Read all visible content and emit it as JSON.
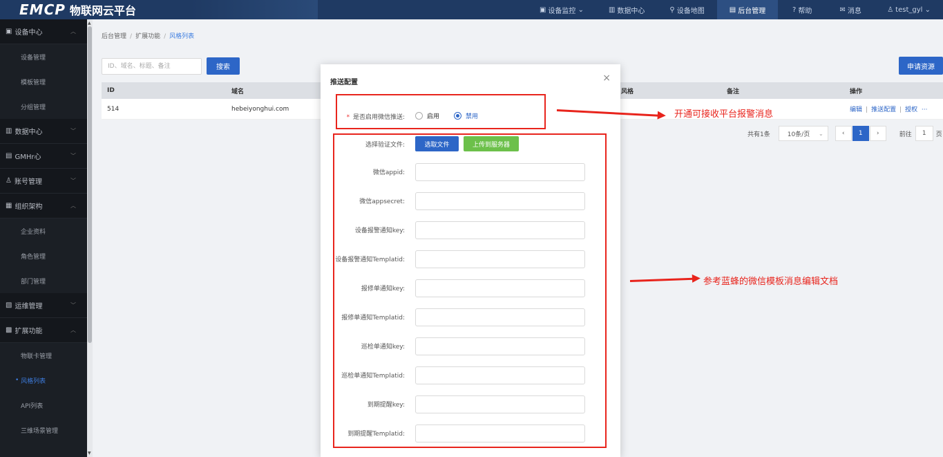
{
  "header": {
    "logo": "EMCP",
    "title": "物联网云平台",
    "nav": [
      {
        "label": "设备监控",
        "icon": "▣",
        "caret": "⌄"
      },
      {
        "label": "数据中心",
        "icon": "▥",
        "caret": ""
      },
      {
        "label": "设备地图",
        "icon": "⚲",
        "caret": ""
      },
      {
        "label": "后台管理",
        "icon": "▤",
        "caret": ""
      },
      {
        "label": "帮助",
        "icon": "?",
        "caret": ""
      },
      {
        "label": "消息",
        "icon": "✉",
        "caret": ""
      },
      {
        "label": "test_gyl",
        "icon": "♙",
        "caret": "⌄"
      }
    ]
  },
  "sidebar": {
    "items": [
      {
        "type": "group",
        "label": "设备中心",
        "icon": "▣",
        "chev": "︿"
      },
      {
        "type": "sub",
        "label": "设备管理"
      },
      {
        "type": "sub",
        "label": "模板管理"
      },
      {
        "type": "sub",
        "label": "分组管理"
      },
      {
        "type": "group",
        "label": "数据中心",
        "icon": "▥",
        "chev": "﹀"
      },
      {
        "type": "group",
        "label": "GMHr心",
        "icon": "▤",
        "chev": "﹀"
      },
      {
        "type": "group",
        "label": "账号管理",
        "icon": "♙",
        "chev": "﹀"
      },
      {
        "type": "group",
        "label": "组织架构",
        "icon": "▦",
        "chev": "︿"
      },
      {
        "type": "sub",
        "label": "企业资料"
      },
      {
        "type": "sub",
        "label": "角色管理"
      },
      {
        "type": "sub",
        "label": "部门管理"
      },
      {
        "type": "group",
        "label": "运维管理",
        "icon": "▧",
        "chev": "﹀"
      },
      {
        "type": "group",
        "label": "扩展功能",
        "icon": "▩",
        "chev": "︿"
      },
      {
        "type": "sub",
        "label": "物联卡管理"
      },
      {
        "type": "sub",
        "label": "风格列表",
        "active": true
      },
      {
        "type": "sub",
        "label": "API列表"
      },
      {
        "type": "sub",
        "label": "三维场景管理"
      }
    ]
  },
  "breadcrumb": [
    "后台管理",
    "扩展功能",
    "风格列表"
  ],
  "search": {
    "placeholder": "ID、域名、标题、备注",
    "button": "搜索"
  },
  "apply_button": "申请资源",
  "table": {
    "columns": [
      "ID",
      "域名",
      "风格",
      "备注",
      "操作"
    ],
    "rows": [
      {
        "id": "514",
        "domain": "hebeiyonghui.com",
        "ops": [
          "编辑",
          "推送配置",
          "授权",
          "···"
        ]
      }
    ]
  },
  "pager": {
    "total": "共有1条",
    "size": "10条/页",
    "size_caret": "⌄",
    "prev": "‹",
    "current": "1",
    "next": "›",
    "goto": "前往",
    "goto_value": "1",
    "suffix": "页"
  },
  "dialog": {
    "title": "推送配置",
    "close": "×",
    "enable_label": "是否启用微信推送:",
    "required_mark": "*",
    "options": [
      "启用",
      "禁用"
    ],
    "selected": "禁用",
    "file_label": "选择验证文件:",
    "pick_button": "选取文件",
    "upload_button": "上传到服务器",
    "fields": [
      "微信appid:",
      "微信appsecret:",
      "设备报警通知key:",
      "设备报警通知Templatid:",
      "报修单通知key:",
      "报修单通知Templatid:",
      "巡检单通知key:",
      "巡检单通知Templatid:",
      "到期提醒key:",
      "到期提醒Templatid:"
    ]
  },
  "annotations": {
    "top": "开通可接收平台报警消息",
    "middle": "参考蓝蜂的微信模板消息编辑文档"
  },
  "colors": {
    "primary": "#2d66c7",
    "success": "#6cc04a",
    "annotation": "#e8241c",
    "header": "#1f3a63",
    "sidebar": "#1b1f25"
  }
}
